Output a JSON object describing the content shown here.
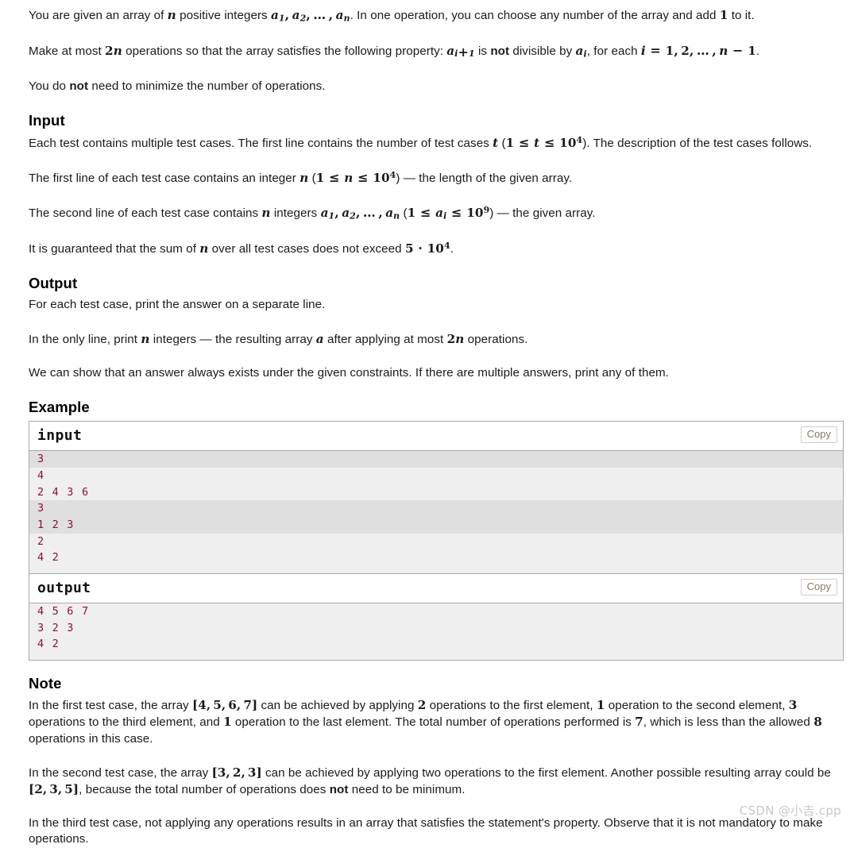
{
  "statement": {
    "p1": {
      "a": "You are given an array of ",
      "var_n": "n",
      "b": " positive integers ",
      "arr": "a₁, a₂, …, aₙ",
      "c": ". In one operation, you can choose any number of the array and add ",
      "one": "1",
      "d": " to it."
    },
    "p2": {
      "a": "Make at most ",
      "twon": "2n",
      "b": " operations so that the array satisfies the following property: ",
      "aip1": "a_{i+1}",
      "c": " is ",
      "not": "not",
      "d": " divisible by ",
      "ai": "a_i",
      "e": ", for each ",
      "range": "i = 1, 2, …, n − 1",
      "f": "."
    },
    "p3": {
      "a": "You do ",
      "not": "not",
      "b": " need to minimize the number of operations."
    }
  },
  "input_section": {
    "heading": "Input",
    "p1": {
      "a": "Each test contains multiple test cases. The first line contains the number of test cases ",
      "var_t": "t",
      "b": " (",
      "constraint": "1 ≤ t ≤ 10⁴",
      "c": "). The description of the test cases follows."
    },
    "p2": {
      "a": "The first line of each test case contains an integer ",
      "var_n": "n",
      "b": " (",
      "constraint": "1 ≤ n ≤ 10⁴",
      "c": ") — the length of the given array."
    },
    "p3": {
      "a": "The second line of each test case contains ",
      "var_n": "n",
      "b": " integers ",
      "arr": "a₁, a₂, …, aₙ",
      "c": " (",
      "constraint": "1 ≤ aᵢ ≤ 10⁹",
      "d": ") — the given array."
    },
    "p4": {
      "a": "It is guaranteed that the sum of ",
      "var_n": "n",
      "b": " over all test cases does not exceed ",
      "bound": "5 · 10⁴",
      "c": "."
    }
  },
  "output_section": {
    "heading": "Output",
    "p1": "For each test case, print the answer on a separate line.",
    "p2": {
      "a": "In the only line, print ",
      "var_n": "n",
      "b": " integers — the resulting array ",
      "var_a": "a",
      "c": " after applying at most ",
      "twon": "2n",
      "d": " operations."
    },
    "p3": "We can show that an answer always exists under the given constraints. If there are multiple answers, print any of them."
  },
  "example_section": {
    "heading": "Example",
    "input_block": {
      "title": "input",
      "copy_label": "Copy",
      "lines": [
        "3",
        "4",
        "2 4 3 6",
        "3",
        "1 2 3",
        "2",
        "4 2"
      ],
      "stripes": [
        "odd",
        "even",
        "even",
        "odd",
        "odd",
        "even",
        "even"
      ]
    },
    "output_block": {
      "title": "output",
      "copy_label": "Copy",
      "lines": [
        "4 5 6 7",
        "3 2 3",
        "4 2"
      ],
      "stripes": [
        "even",
        "even",
        "even"
      ]
    }
  },
  "note_section": {
    "heading": "Note",
    "p1": {
      "a": "In the first test case, the array ",
      "arr1": "[4, 5, 6, 7]",
      "b": " can be achieved by applying ",
      "n2": "2",
      "c": " operations to the first element, ",
      "n1": "1",
      "d": " operation to the second element, ",
      "n3": "3",
      "e": " operations to the third element, and ",
      "n1b": "1",
      "f": " operation to the last element. The total number of operations performed is ",
      "n7": "7",
      "g": ", which is less than the allowed ",
      "n8": "8",
      "h": " operations in this case."
    },
    "p2": {
      "a": "In the second test case, the array ",
      "arr1": "[3, 2, 3]",
      "b": " can be achieved by applying two operations to the first element. Another possible resulting array could be ",
      "arr2": "[2, 3, 5]",
      "c": ", because the total number of operations does ",
      "not": "not",
      "d": " need to be minimum."
    },
    "p3": "In the third test case, not applying any operations results in an array that satisfies the statement's property. Observe that it is not mandatory to make operations."
  },
  "watermark": {
    "text": "CSDN @小吉.cpp",
    "color": "#c8c8c8"
  },
  "colors": {
    "code_text": "#8d132b",
    "stripe_dark": "#dfdfdf",
    "stripe_light": "#efefef",
    "border": "#a8a8a8",
    "copy_text": "#8a7a66"
  }
}
